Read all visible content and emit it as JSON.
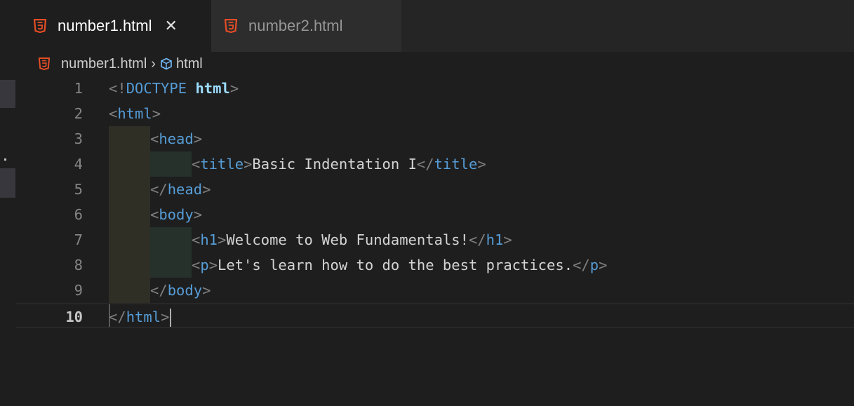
{
  "tabs": [
    {
      "label": "number1.html",
      "active": true,
      "close_glyph": "✕"
    },
    {
      "label": "number2.html",
      "active": false
    }
  ],
  "breadcrumb": {
    "file": "number1.html",
    "separator": "›",
    "symbol": "html"
  },
  "icons": {
    "file_icon": "html5-icon",
    "symbol_icon": "cube-icon"
  },
  "colors": {
    "html5_orange": "#e44d26",
    "tag_blue": "#569cd6",
    "punct_gray": "#808080",
    "text": "#d4d4d4",
    "line_number": "#858585"
  },
  "editor": {
    "lines": [
      {
        "num": "1",
        "parts": [
          {
            "t": "<!",
            "c": "punct"
          },
          {
            "t": "DOCTYPE",
            "c": "doctype"
          },
          {
            "t": " ",
            "c": "text"
          },
          {
            "t": "html",
            "c": "doctype-kw"
          },
          {
            "t": ">",
            "c": "punct"
          }
        ],
        "indent": 0
      },
      {
        "num": "2",
        "parts": [
          {
            "t": "<",
            "c": "punct"
          },
          {
            "t": "html",
            "c": "tag"
          },
          {
            "t": ">",
            "c": "punct"
          }
        ],
        "indent": 0
      },
      {
        "num": "3",
        "parts": [
          {
            "t": "<",
            "c": "punct"
          },
          {
            "t": "head",
            "c": "tag"
          },
          {
            "t": ">",
            "c": "punct"
          }
        ],
        "indent": 1
      },
      {
        "num": "4",
        "parts": [
          {
            "t": "<",
            "c": "punct"
          },
          {
            "t": "title",
            "c": "tag"
          },
          {
            "t": ">",
            "c": "punct"
          },
          {
            "t": "Basic Indentation I",
            "c": "text"
          },
          {
            "t": "</",
            "c": "punct"
          },
          {
            "t": "title",
            "c": "tag"
          },
          {
            "t": ">",
            "c": "punct"
          }
        ],
        "indent": 2
      },
      {
        "num": "5",
        "parts": [
          {
            "t": "</",
            "c": "punct"
          },
          {
            "t": "head",
            "c": "tag"
          },
          {
            "t": ">",
            "c": "punct"
          }
        ],
        "indent": 1
      },
      {
        "num": "6",
        "parts": [
          {
            "t": "<",
            "c": "punct"
          },
          {
            "t": "body",
            "c": "tag"
          },
          {
            "t": ">",
            "c": "punct"
          }
        ],
        "indent": 1
      },
      {
        "num": "7",
        "parts": [
          {
            "t": "<",
            "c": "punct"
          },
          {
            "t": "h1",
            "c": "tag"
          },
          {
            "t": ">",
            "c": "punct"
          },
          {
            "t": "Welcome to Web Fundamentals!",
            "c": "text"
          },
          {
            "t": "</",
            "c": "punct"
          },
          {
            "t": "h1",
            "c": "tag"
          },
          {
            "t": ">",
            "c": "punct"
          }
        ],
        "indent": 2
      },
      {
        "num": "8",
        "parts": [
          {
            "t": "<",
            "c": "punct"
          },
          {
            "t": "p",
            "c": "tag"
          },
          {
            "t": ">",
            "c": "punct"
          },
          {
            "t": "Let's learn how to do the best practices.",
            "c": "text"
          },
          {
            "t": "</",
            "c": "punct"
          },
          {
            "t": "p",
            "c": "tag"
          },
          {
            "t": ">",
            "c": "punct"
          }
        ],
        "indent": 2
      },
      {
        "num": "9",
        "parts": [
          {
            "t": "</",
            "c": "punct"
          },
          {
            "t": "body",
            "c": "tag"
          },
          {
            "t": ">",
            "c": "punct"
          }
        ],
        "indent": 1
      },
      {
        "num": "10",
        "parts": [
          {
            "t": "</",
            "c": "punct"
          },
          {
            "t": "html",
            "c": "tag"
          },
          {
            "t": ">",
            "c": "punct"
          }
        ],
        "indent": 0,
        "current": true
      }
    ]
  }
}
